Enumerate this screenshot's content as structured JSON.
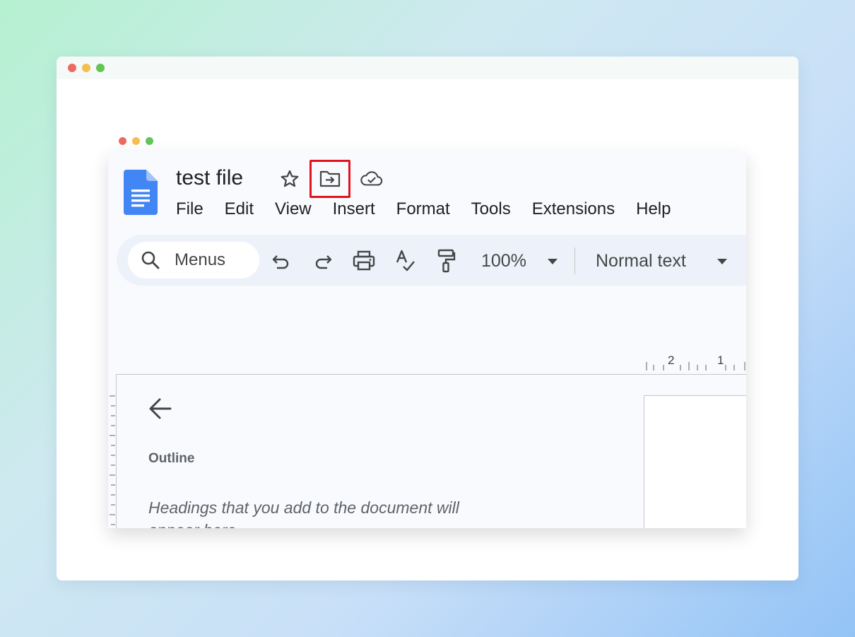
{
  "document": {
    "title": "test file"
  },
  "title_icons": {
    "star": "star-icon",
    "move": "move-to-folder-icon",
    "cloud": "cloud-saved-icon"
  },
  "menu": {
    "items": [
      "File",
      "Edit",
      "View",
      "Insert",
      "Format",
      "Tools",
      "Extensions",
      "Help"
    ]
  },
  "toolbar": {
    "search_label": "Menus",
    "zoom": "100%",
    "paragraph_style": "Normal text",
    "icons": [
      "search-icon",
      "undo-icon",
      "redo-icon",
      "print-icon",
      "spellcheck-icon",
      "paint-format-icon",
      "zoom-dropdown-icon",
      "style-dropdown-icon"
    ]
  },
  "ruler": {
    "labels": [
      "2",
      "1"
    ]
  },
  "outline": {
    "title": "Outline",
    "empty_message": "Headings that you add to the document will appear here."
  },
  "colors": {
    "highlight": "#e0141e",
    "docs_blue": "#4285f4",
    "toolbar_bg": "#edf2fa"
  }
}
